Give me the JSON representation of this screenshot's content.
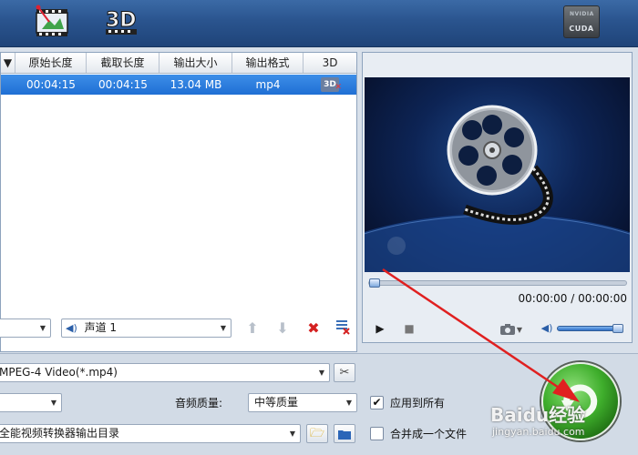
{
  "toolbar": {
    "buttons": [
      {
        "name": "edit-video-icon"
      },
      {
        "name": "3d-icon",
        "label": "3D"
      }
    ],
    "cuda_badge": {
      "brand": "NVIDIA",
      "label": "CUDA"
    }
  },
  "file_table": {
    "columns": [
      "原始长度",
      "截取长度",
      "输出大小",
      "输出格式",
      "3D"
    ],
    "rows": [
      {
        "original_length": "00:04:15",
        "clip_length": "00:04:15",
        "output_size": "13.04 MB",
        "output_format": "mp4",
        "three_d_badge": "3D"
      }
    ]
  },
  "track_controls": {
    "audio_track": "声道 1"
  },
  "preview": {
    "timecode": "00:00:00 / 00:00:00",
    "seek_progress": 0,
    "volume_level": 1.0
  },
  "settings": {
    "output_format": "MPEG-4 Video(*.mp4)",
    "audio_quality_label": "音频质量:",
    "audio_quality_value": "中等质量",
    "apply_all_label": "应用到所有",
    "apply_all_checked": true,
    "output_dir": "全能视频转换器输出目录",
    "merge_label": "合并成一个文件",
    "merge_checked": false
  },
  "watermark": {
    "main": "Baidu经验",
    "sub": "jingyan.baidu.com"
  },
  "colors": {
    "toolbar": "#2a548e",
    "selected_row": "#2a7de0",
    "convert_green": "#3fae2c",
    "annotation_arrow": "#e02020",
    "delete_red": "#d42020"
  }
}
